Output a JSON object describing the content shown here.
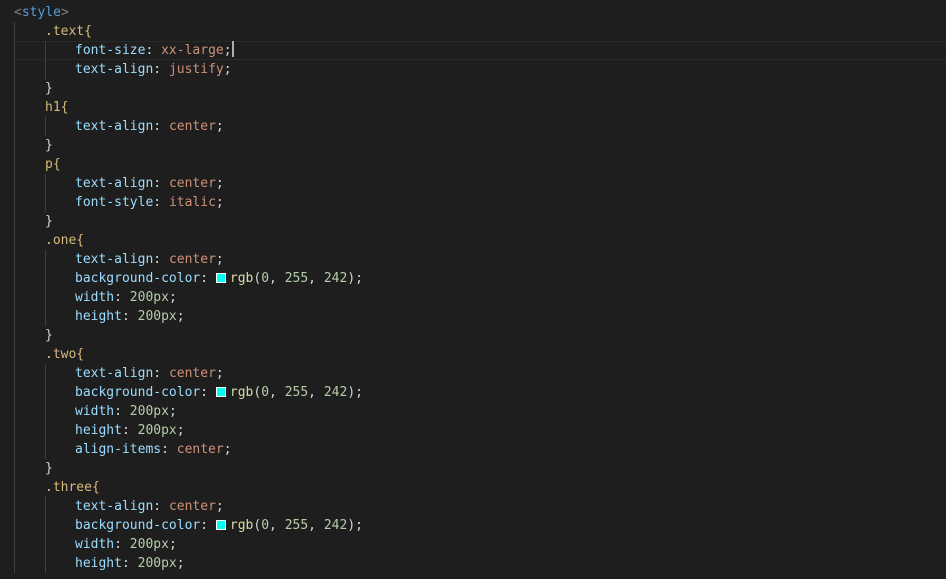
{
  "colors": {
    "background": "#1e1e1e",
    "swatch": "#00fff2"
  },
  "lines": [
    {
      "type": "tag",
      "bracket_open": "<",
      "name": "style",
      "bracket_close": ">"
    },
    {
      "type": "selector",
      "text": ".text{"
    },
    {
      "type": "decl",
      "prop": "font-size",
      "value": "xx-large",
      "cursor": true
    },
    {
      "type": "decl",
      "prop": "text-align",
      "value": "justify"
    },
    {
      "type": "close",
      "text": "}"
    },
    {
      "type": "selector",
      "text": "h1{"
    },
    {
      "type": "decl",
      "prop": "text-align",
      "value": "center"
    },
    {
      "type": "close",
      "text": "}"
    },
    {
      "type": "selector",
      "text": "p{"
    },
    {
      "type": "decl",
      "prop": "text-align",
      "value": "center"
    },
    {
      "type": "decl",
      "prop": "font-style",
      "value": "italic"
    },
    {
      "type": "close",
      "text": "}"
    },
    {
      "type": "selector",
      "text": ".one{"
    },
    {
      "type": "decl",
      "prop": "text-align",
      "value": "center"
    },
    {
      "type": "color",
      "prop": "background-color",
      "fn": "rgb",
      "args": [
        "0",
        "255",
        "242"
      ]
    },
    {
      "type": "num",
      "prop": "width",
      "value": "200px"
    },
    {
      "type": "num",
      "prop": "height",
      "value": "200px"
    },
    {
      "type": "close",
      "text": "}"
    },
    {
      "type": "selector",
      "text": ".two{"
    },
    {
      "type": "decl",
      "prop": "text-align",
      "value": "center"
    },
    {
      "type": "color",
      "prop": "background-color",
      "fn": "rgb",
      "args": [
        "0",
        "255",
        "242"
      ]
    },
    {
      "type": "num",
      "prop": "width",
      "value": "200px"
    },
    {
      "type": "num",
      "prop": "height",
      "value": "200px"
    },
    {
      "type": "decl",
      "prop": "align-items",
      "value": "center"
    },
    {
      "type": "close",
      "text": "}"
    },
    {
      "type": "selector",
      "text": ".three{"
    },
    {
      "type": "decl",
      "prop": "text-align",
      "value": "center"
    },
    {
      "type": "color",
      "prop": "background-color",
      "fn": "rgb",
      "args": [
        "0",
        "255",
        "242"
      ]
    },
    {
      "type": "num",
      "prop": "width",
      "value": "200px"
    },
    {
      "type": "num",
      "prop": "height",
      "value": "200px"
    }
  ]
}
